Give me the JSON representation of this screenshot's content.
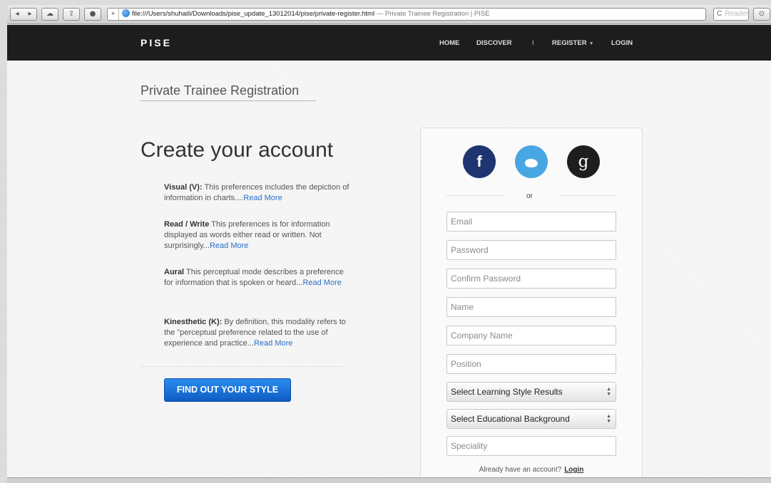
{
  "browser": {
    "url": "file:///Users/shuhaili/Downloads/pise_update_13012014/pise/private-register.html",
    "tab_title": "— Private Trainee Registration | PISE",
    "reader_label": "Reader",
    "reload_glyph": "C"
  },
  "nav": {
    "brand": "PISE",
    "items": [
      {
        "label": "HOME"
      },
      {
        "label": "DISCOVER"
      },
      {
        "label": "I"
      },
      {
        "label": "REGISTER",
        "caret": "▼"
      },
      {
        "label": "LOGIN"
      }
    ]
  },
  "page": {
    "subtitle": "Private Trainee Registration",
    "headline": "Create your account",
    "preferences": [
      {
        "title": "Visual (V):",
        "text": " This preferences includes the depiction of information in charts....",
        "link": "Read More"
      },
      {
        "title": "Read / Write",
        "text": " This preferences is for information displayed as words either read or written. Not surprisingly...",
        "link": "Read More"
      },
      {
        "title": "Aural",
        "text": " This perceptual mode describes a preference for information that is spoken or heard...",
        "link": "Read More"
      },
      {
        "title": "Kinesthetic (K):",
        "text": " By definition, this modality refers to the \"perceptual preference related to the use of experience and practice...",
        "link": "Read More"
      }
    ],
    "cta_label": "FIND OUT YOUR STYLE"
  },
  "form": {
    "social": {
      "facebook": "f",
      "google": "g"
    },
    "or_label": "or",
    "fields": {
      "email": {
        "placeholder": "Email"
      },
      "password": {
        "placeholder": "Password"
      },
      "confirm": {
        "placeholder": "Confirm Password"
      },
      "name": {
        "placeholder": "Name"
      },
      "company": {
        "placeholder": "Company Name"
      },
      "position": {
        "placeholder": "Position"
      },
      "speciality": {
        "placeholder": "Speciality"
      }
    },
    "selects": {
      "learning_style": "Select Learning Style Results",
      "education": "Select Educational Background"
    },
    "already_text": "Already have an account?",
    "login_link": "Login"
  },
  "colors": {
    "navbar": "#1d1d1d",
    "cta": "#1a72dc",
    "link": "#2a6fc9",
    "facebook": "#1f3571",
    "twitter": "#48a6e3",
    "google": "#1e1e1e"
  }
}
